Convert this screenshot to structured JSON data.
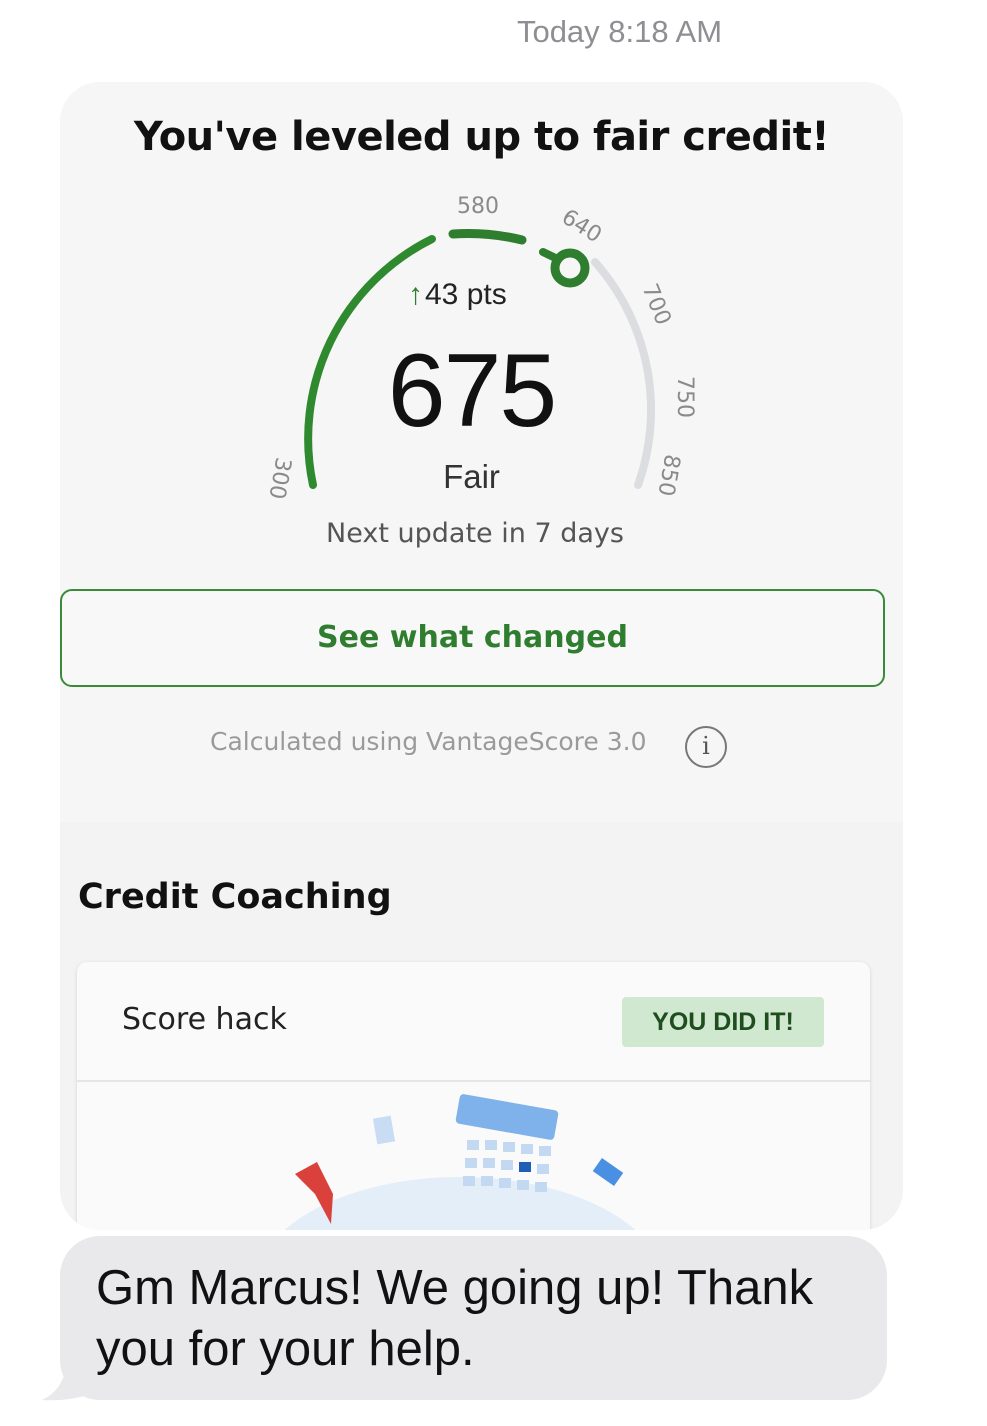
{
  "thread": {
    "timestamp": "Today 8:18 AM"
  },
  "card": {
    "headline": "You've leveled up to fair credit!",
    "gauge": {
      "score": "675",
      "change": "43 pts",
      "change_direction": "up",
      "rating": "Fair",
      "tick_labels": [
        "300",
        "580",
        "640",
        "700",
        "750",
        "850"
      ],
      "next_update": "Next update in 7 days"
    },
    "cta_label": "See what changed",
    "calculated_note": "Calculated using VantageScore 3.0",
    "coaching": {
      "title": "Credit Coaching",
      "item_label": "Score hack",
      "badge": "YOU DID IT!"
    }
  },
  "message": {
    "text": "Gm Marcus! We going up! Thank you for your help."
  },
  "colors": {
    "accent_green": "#2f7d2f",
    "gauge_gray": "#dcdde0",
    "badge_bg": "#cfe8cf",
    "bubble_gray": "#e9e9eb"
  }
}
